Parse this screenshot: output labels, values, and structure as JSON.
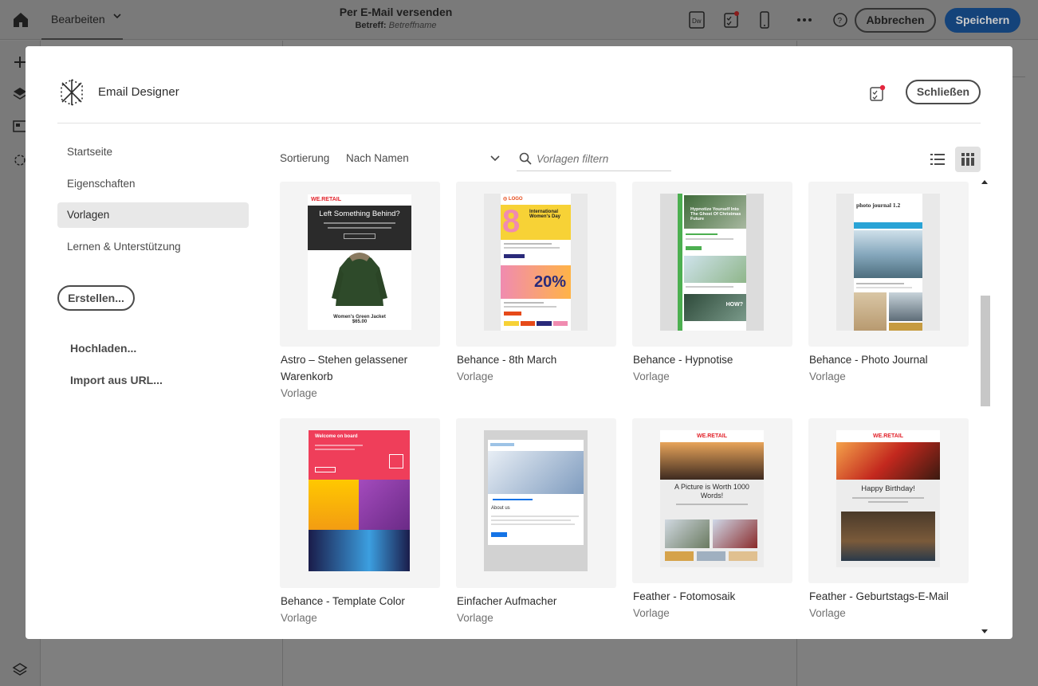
{
  "app_header": {
    "edit_menu_label": "Bearbeiten",
    "title": "Per E-Mail versenden",
    "subject_label": "Betreff:",
    "subject_value": "Betreffname",
    "cancel_label": "Abbrechen",
    "save_label": "Speichern"
  },
  "modal": {
    "title": "Email Designer",
    "close_label": "Schließen",
    "nav": {
      "items": [
        {
          "label": "Startseite"
        },
        {
          "label": "Eigenschaften"
        },
        {
          "label": "Vorlagen"
        },
        {
          "label": "Lernen & Unterstützung"
        }
      ],
      "active": "Vorlagen"
    },
    "create_label": "Erstellen...",
    "upload_label": "Hochladen...",
    "import_label": "Import aus URL...",
    "toolbar": {
      "sort_label": "Sortierung",
      "sort_value": "Nach Namen",
      "filter_placeholder": "Vorlagen filtern"
    },
    "templates": [
      {
        "name": "Astro – Stehen gelassener Warenkorb",
        "type": "Vorlage"
      },
      {
        "name": "Behance - 8th March",
        "type": "Vorlage"
      },
      {
        "name": "Behance - Hypnotise",
        "type": "Vorlage"
      },
      {
        "name": "Behance - Photo Journal",
        "type": "Vorlage"
      },
      {
        "name": "Behance - Template Color",
        "type": "Vorlage"
      },
      {
        "name": "Einfacher Aufmacher",
        "type": "Vorlage"
      },
      {
        "name": "Feather - Fotomosaik",
        "type": "Vorlage"
      },
      {
        "name": "Feather - Geburtstags-E-Mail",
        "type": "Vorlage"
      }
    ],
    "previews": {
      "astro_brand": "WE.RETAIL",
      "astro_headline": "Left Something Behind?",
      "astro_price": "$65.00",
      "astro_product": "Women's Green Jacket",
      "march_date": "8",
      "march_title": "International Women's Day",
      "march_discount": "20%",
      "hyp_headline": "Hypnotize Yourself Into The Ghost Of Christmas Future",
      "hyp_how": "HOW?",
      "pj_title": "photo journal 1.2",
      "tc_title": "Welcome on board",
      "ea_section": "About us",
      "mosaic_brand": "WE.RETAIL",
      "mosaic_headline": "A Picture is Worth 1000 Words!",
      "bday_brand": "WE.RETAIL",
      "bday_headline": "Happy Birthday!"
    }
  },
  "colors": {
    "accent_blue": "#1473e6",
    "overlay": "#7f7f7f",
    "active_nav": "#e8e8e8"
  }
}
